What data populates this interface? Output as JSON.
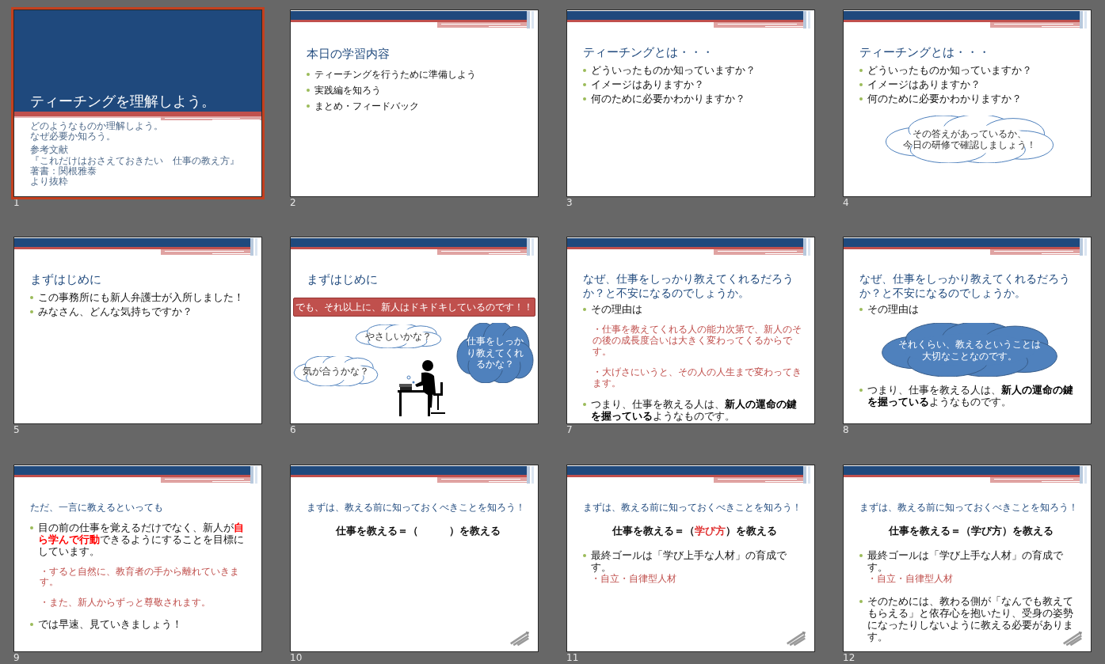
{
  "slides": [
    {
      "number": "1",
      "selected": true,
      "kind": "title",
      "title": "ティーチングを理解しよう。",
      "subtitle": [
        "どのようなものか理解しよう。",
        "なぜ必要か知ろう。"
      ],
      "notes": [
        "参考文献",
        "『これだけはおさえておきたい　仕事の教え方』",
        "著書：関根雅泰",
        "より抜粋"
      ]
    },
    {
      "number": "2",
      "selected": false,
      "kind": "agenda",
      "title": "本日の学習内容",
      "items": [
        {
          "kind": "bullet",
          "text": "ティーチングを行うために準備しよう"
        },
        {
          "kind": "bullet",
          "text": "実践編を知ろう"
        },
        {
          "kind": "bullet",
          "text": "まとめ・フィードバック"
        }
      ]
    },
    {
      "number": "3",
      "selected": false,
      "kind": "content",
      "title": "ティーチングとは・・・",
      "items": [
        {
          "kind": "bullet",
          "text": "どういったものか知っていますか？"
        },
        {
          "kind": "bullet",
          "text": "イメージはありますか？"
        },
        {
          "kind": "bullet",
          "text": "何のために必要かわかりますか？"
        }
      ]
    },
    {
      "number": "4",
      "selected": false,
      "kind": "content",
      "title": "ティーチングとは・・・",
      "items": [
        {
          "kind": "bullet",
          "text": "どういったものか知っていますか？"
        },
        {
          "kind": "bullet",
          "text": "イメージはありますか？"
        },
        {
          "kind": "bullet",
          "text": "何のために必要かわかりますか？"
        },
        {
          "kind": "outline-cloud",
          "lines": [
            "その答えがあっているか、",
            "今日の研修で確認しましょう！"
          ]
        }
      ]
    },
    {
      "number": "5",
      "selected": false,
      "kind": "content",
      "title": "まずはじめに",
      "items": [
        {
          "kind": "bullet",
          "text": "この事務所にも新人弁護士が入所しました！"
        },
        {
          "kind": "bullet",
          "text": "みなさん、どんな気持ちですか？"
        }
      ]
    },
    {
      "number": "6",
      "selected": false,
      "kind": "content",
      "title": "まずはじめに",
      "overlays": [
        {
          "kind": "banner",
          "lines": [
            "でも、それ以上に、新人はドキドキしているのです！！"
          ]
        },
        {
          "kind": "top-cloud",
          "lines": [
            "やさしいかな？"
          ]
        },
        {
          "kind": "left-cloud",
          "lines": [
            "気が合うかな？"
          ]
        },
        {
          "kind": "right-cloud",
          "lines": [
            "仕事をしっか",
            "り教えてくれ",
            "るかな？"
          ]
        },
        {
          "kind": "picture"
        }
      ]
    },
    {
      "number": "7",
      "selected": false,
      "kind": "content",
      "title": "なぜ、仕事をしっかり教えてくれるだろうか？と不安になるのでしょうか。",
      "items": [
        {
          "kind": "bullet",
          "text": "その理由は"
        },
        {
          "kind": "sub",
          "text": "・仕事を教えてくれる人の能力次第で、新人のその後の成長度合いは大きく変わってくるからです。"
        },
        {
          "kind": "sub",
          "text": "・大げさにいうと、その人の人生まで変わってきます。"
        },
        {
          "kind": "bullet",
          "accent": false,
          "text": "つまり、仕事を教える人は、**新人の運命の鍵を握っている**ようなものです。"
        }
      ]
    },
    {
      "number": "8",
      "selected": false,
      "kind": "content",
      "title": "なぜ、仕事をしっかり教えてくれるだろうか？と不安になるのでしょうか。",
      "items": [
        {
          "kind": "bullet",
          "text": "その理由は"
        },
        {
          "kind": "filled-cloud",
          "lines": [
            "それくらい、教えるということは",
            "大切なことなのです。"
          ]
        },
        {
          "kind": "bullet",
          "accent": false,
          "text": "つまり、仕事を教える人は、**新人の運命の鍵を握っている**ようなものです。"
        }
      ]
    },
    {
      "number": "9",
      "selected": false,
      "kind": "lesson",
      "title": "ただ、一言に教えるといっても",
      "items": [
        {
          "kind": "bullet",
          "accent": true,
          "text": "目の前の仕事を覚えるだけでなく、新人が**自ら学んで行動**できるようにすることを目標にしています。"
        },
        {
          "kind": "sub",
          "text": "・すると自然に、教育者の手から離れていきます。"
        },
        {
          "kind": "sub",
          "text": "・また、新人からずっと尊敬されます。"
        },
        {
          "kind": "bullet",
          "text": "では早速、見ていきましょう！"
        }
      ]
    },
    {
      "number": "10",
      "selected": false,
      "kind": "lesson",
      "footer_icon": true,
      "title": "まずは、教える前に知っておくべきことを知ろう！",
      "items": [
        {
          "kind": "formula",
          "parts": [
            "仕事を教える＝（　　　）を教える"
          ]
        }
      ]
    },
    {
      "number": "11",
      "selected": false,
      "kind": "lesson",
      "footer_icon": true,
      "title": "まずは、教える前に知っておくべきことを知ろう！",
      "items": [
        {
          "kind": "formula",
          "highlight": true,
          "parts": [
            "仕事を教える＝（",
            "学び方",
            "）を教える"
          ]
        },
        {
          "kind": "bullet",
          "text": "最終ゴールは「学び上手な人材」の育成です。"
        },
        {
          "kind": "note",
          "text": "・自立・自律型人材"
        }
      ]
    },
    {
      "number": "12",
      "selected": false,
      "kind": "lesson",
      "footer_icon": true,
      "title": "まずは、教える前に知っておくべきことを知ろう！",
      "items": [
        {
          "kind": "formula",
          "highlight": false,
          "parts": [
            "仕事を教える＝（",
            "学び方",
            "）を教える"
          ]
        },
        {
          "kind": "bullet",
          "text": "最終ゴールは「学び上手な人材」の育成です。"
        },
        {
          "kind": "note",
          "text": "・自立・自律型人材"
        },
        {
          "kind": "bullet",
          "text": "そのためには、教わる側が「なんでも教えてもらえる」と依存心を抱いたり、受身の姿勢になったりしないように教える必要があります。"
        }
      ]
    }
  ]
}
